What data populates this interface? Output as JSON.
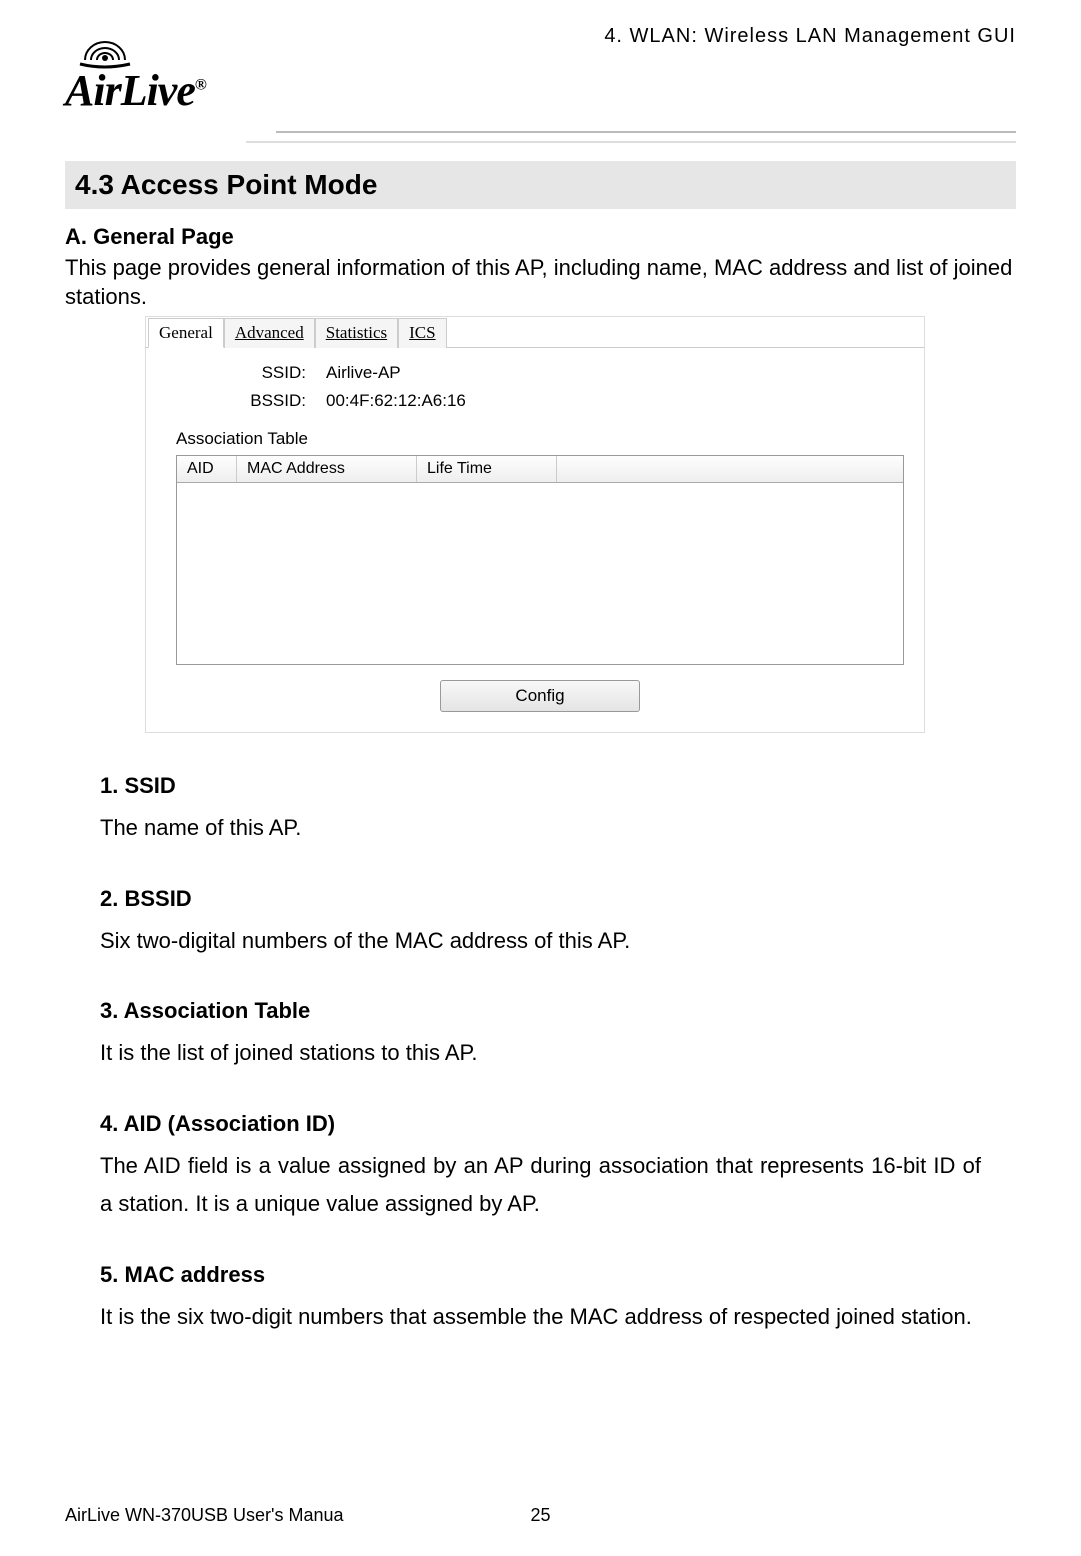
{
  "header": {
    "logo_text": "AirLive",
    "logo_r": "®",
    "breadcrumb": "4. WLAN: Wireless LAN Management GUI"
  },
  "section": {
    "number_title": "4.3  Access  Point  Mode",
    "sub_a": "A. General Page",
    "sub_a_body": "This page provides general information of this AP, including name, MAC address and list of joined stations."
  },
  "screenshot": {
    "tabs": [
      {
        "label": "General",
        "active": true
      },
      {
        "label": "Advanced",
        "active": false
      },
      {
        "label": "Statistics",
        "active": false
      },
      {
        "label": "ICS",
        "active": false
      }
    ],
    "ssid_label": "SSID:",
    "ssid_value": "Airlive-AP",
    "bssid_label": "BSSID:",
    "bssid_value": "00:4F:62:12:A6:16",
    "assoc_label": "Association Table",
    "table_headers": {
      "aid": "AID",
      "mac": "MAC Address",
      "life": "Life Time"
    },
    "config_button": "Config"
  },
  "definitions": [
    {
      "title": "1. SSID",
      "body": "The name of this AP."
    },
    {
      "title": "2. BSSID",
      "body": "Six two-digital numbers of the MAC address of this AP."
    },
    {
      "title": "3. Association Table",
      "body": "It is the list of joined stations to this AP."
    },
    {
      "title": "4. AID (Association ID)",
      "body": "The AID field is a value assigned by an AP during association that represents 16-bit ID of a station. It is a unique value assigned by AP.",
      "justify": true
    },
    {
      "title": "5. MAC address",
      "body": "It is the six two-digit numbers that assemble the MAC address of respected joined station."
    }
  ],
  "footer": {
    "left": "AirLive WN-370USB User's Manua",
    "page": "25"
  }
}
